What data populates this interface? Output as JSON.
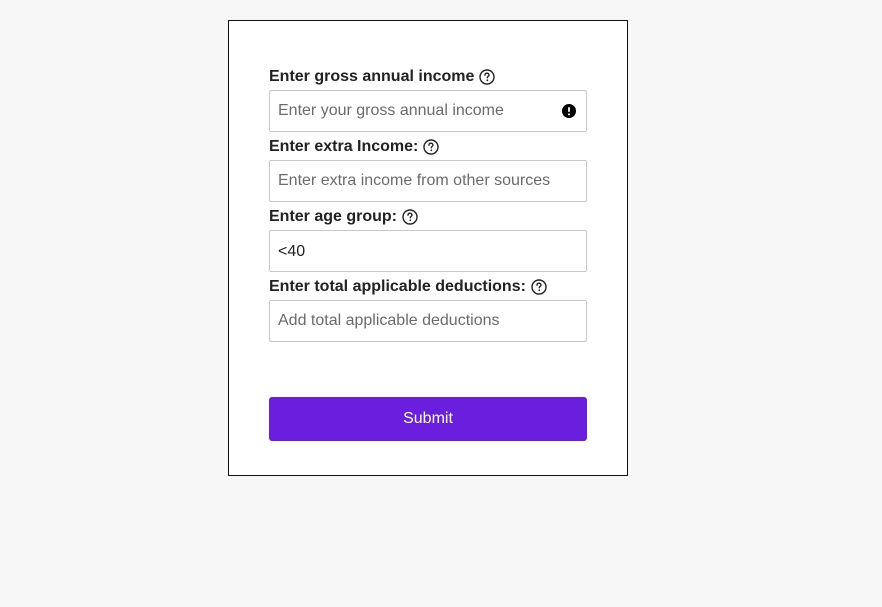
{
  "form": {
    "gross_income": {
      "label": "Enter gross annual income",
      "placeholder": "Enter your gross annual income",
      "value": "",
      "help_icon": "help-circle-icon",
      "error_icon": "exclamation-circle-icon"
    },
    "extra_income": {
      "label": "Enter extra Income:",
      "placeholder": "Enter extra income from other sources",
      "value": "",
      "help_icon": "help-circle-icon"
    },
    "age_group": {
      "label": "Enter age group:",
      "selected": "<40",
      "help_icon": "help-circle-icon"
    },
    "deductions": {
      "label": "Enter total applicable deductions:",
      "placeholder": "Add total applicable deductions",
      "value": "",
      "help_icon": "help-circle-icon"
    },
    "submit_label": "Submit"
  },
  "colors": {
    "accent": "#6a1fde",
    "page_background": "#f7f7f7",
    "card_background": "#ffffff",
    "label_text": "#222222"
  }
}
